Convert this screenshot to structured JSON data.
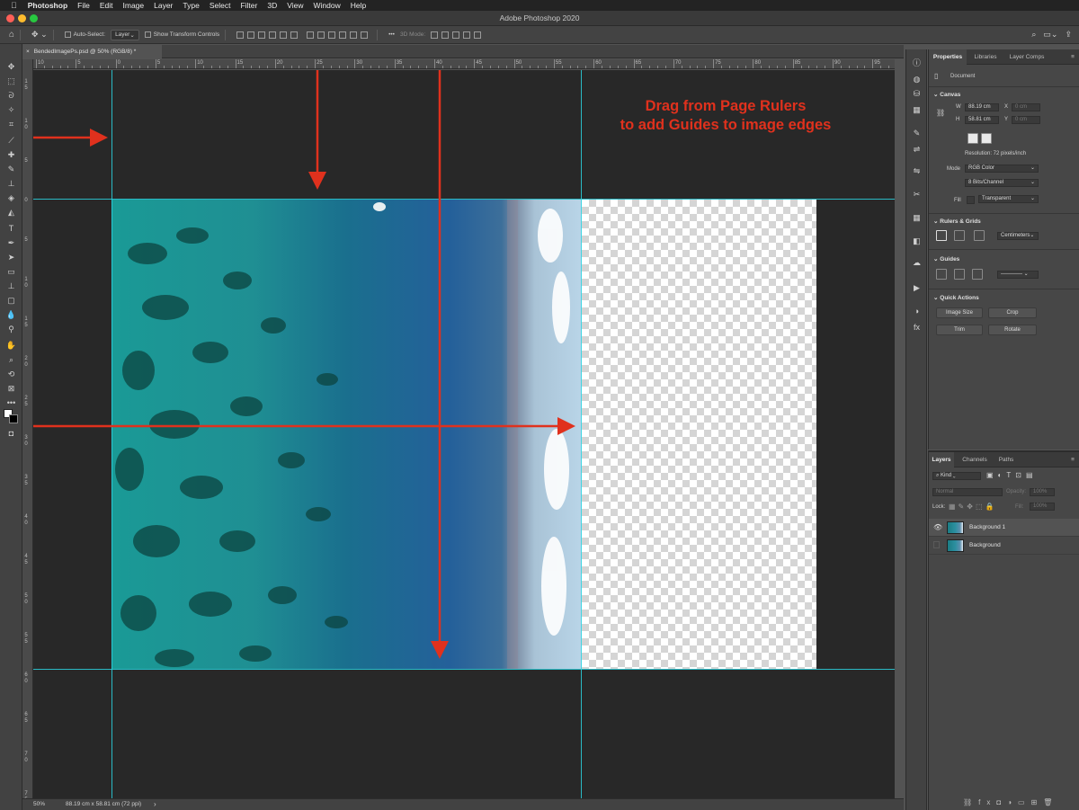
{
  "menubar": {
    "app": "Photoshop",
    "items": [
      "File",
      "Edit",
      "Image",
      "Layer",
      "Type",
      "Select",
      "Filter",
      "3D",
      "View",
      "Window",
      "Help"
    ]
  },
  "window": {
    "title": "Adobe Photoshop 2020"
  },
  "options": {
    "auto_select_label": "Auto-Select:",
    "auto_select_value": "Layer",
    "show_transform_label": "Show Transform Controls",
    "mode_3d": "3D Mode:"
  },
  "document": {
    "tab_label": "BendedImagePs.psd @ 50% (RGB/8) *",
    "zoom": "50%",
    "doc_info": "88.19 cm x 58.81 cm (72 ppi)"
  },
  "annotation": {
    "line1": "Drag from Page Rulers",
    "line2": "to add Guides to image edges",
    "color": "#e0311d"
  },
  "rulers": {
    "top_labels": [
      "10",
      "5",
      "0",
      "5",
      "10",
      "15",
      "20",
      "25",
      "30",
      "35",
      "40",
      "45",
      "50",
      "55",
      "60",
      "65",
      "70",
      "75",
      "80",
      "85",
      "90",
      "95"
    ],
    "left_labels": [
      "1\n5",
      "1\n0",
      "5",
      "0",
      "5",
      "1\n0",
      "1\n5",
      "2\n0",
      "2\n5",
      "3\n0",
      "3\n5",
      "4\n0",
      "4\n5",
      "5\n0",
      "5\n5",
      "6\n0",
      "6\n5",
      "7\n0",
      "7\n5"
    ]
  },
  "properties_panel": {
    "tabs": [
      "Properties",
      "Libraries",
      "Layer Comps"
    ],
    "doc_label": "Document",
    "canvas": {
      "header": "Canvas",
      "w_label": "W",
      "w_value": "88.19 cm",
      "h_label": "H",
      "h_value": "58.81 cm",
      "x_label": "X",
      "x_value": "0 cm",
      "y_label": "Y",
      "y_value": "0 cm",
      "resolution": "Resolution: 72 pixels/inch",
      "mode_label": "Mode",
      "mode_value": "RGB Color",
      "bits_value": "8 Bits/Channel",
      "fill_label": "Fill",
      "fill_value": "Transparent"
    },
    "rulers_grids": {
      "header": "Rulers & Grids",
      "units": "Centimeters"
    },
    "guides": {
      "header": "Guides"
    },
    "quick_actions": {
      "header": "Quick Actions",
      "buttons": [
        "Image Size",
        "Crop",
        "Trim",
        "Rotate"
      ]
    }
  },
  "layers_panel": {
    "tabs": [
      "Layers",
      "Channels",
      "Paths"
    ],
    "filter_kind": "Kind",
    "blend_mode": "Normal",
    "opacity_label": "Opacity:",
    "opacity_value": "100%",
    "lock_label": "Lock:",
    "fill_label": "Fill:",
    "fill_value": "100%",
    "layers": [
      "Background 1",
      "Background"
    ]
  },
  "guide_color": "#2ad3e0",
  "icons": {
    "toolbar": [
      "move-tool-icon",
      "marquee-tool-icon",
      "lasso-tool-icon",
      "magic-wand-icon",
      "crop-tool-icon",
      "eyedropper-icon",
      "healing-brush-icon",
      "brush-tool-icon",
      "clone-stamp-icon",
      "history-brush-icon",
      "eraser-icon",
      "gradient-icon",
      "type-tool-icon",
      "pen-tool-icon",
      "path-select-icon",
      "rectangle-tool-icon",
      "hand-tool-icon",
      "zoom-tool-icon"
    ]
  }
}
